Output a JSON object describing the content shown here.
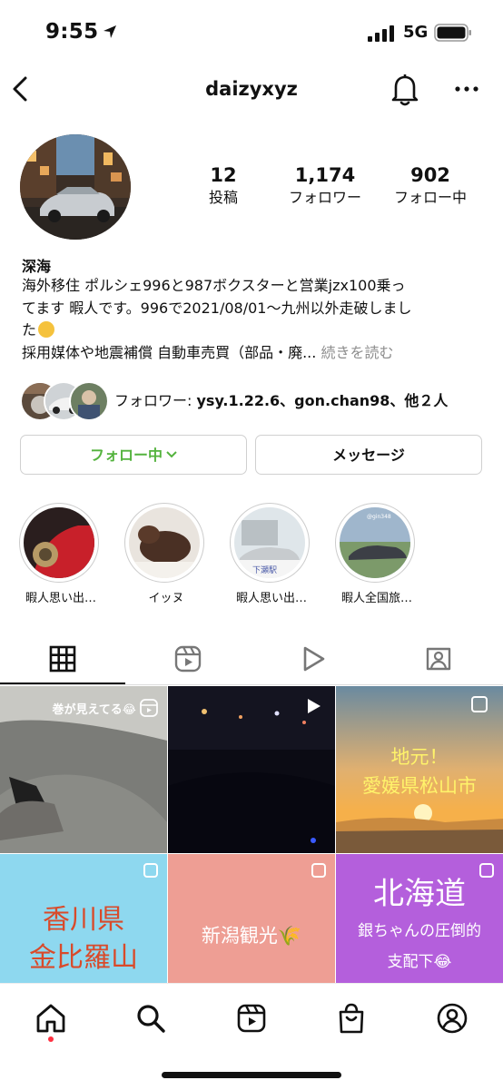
{
  "status_bar": {
    "time": "9:55",
    "network": "5G"
  },
  "header": {
    "username": "daizyxyz"
  },
  "profile": {
    "display_name": "深海",
    "stats": [
      {
        "value": "12",
        "label": "投稿"
      },
      {
        "value": "1,174",
        "label": "フォロワー"
      },
      {
        "value": "902",
        "label": "フォロー中"
      }
    ],
    "bio_lines": [
      "海外移住 ポルシェ996と987ボクスターと営業jzx100乗っ",
      "てます 暇人です。996で2021/08/01〜九州以外走破しまし",
      "た",
      "採用媒体や地震補償 自動車売買（部品・廃..."
    ],
    "bio_more": "続きを読む",
    "mutual_followers": {
      "prefix": "フォロワー: ",
      "names": "ysy.1.22.6、gon.chan98",
      "suffix": "、他２人"
    }
  },
  "actions": {
    "follow_label": "フォロー中",
    "message_label": "メッセージ"
  },
  "highlights": [
    {
      "label": "暇人思い出…"
    },
    {
      "label": "イッヌ"
    },
    {
      "label": "暇人思い出…"
    },
    {
      "label": "暇人全国旅…"
    }
  ],
  "highlight_texts": {
    "station_sign": "下瀬駅",
    "tag": "@gin348"
  },
  "grid": {
    "post1_caption": "巻が見えてる😂",
    "post3_text": [
      "地元！",
      "愛媛県松山市"
    ],
    "post4_text": [
      "香川県",
      "金比羅山"
    ],
    "post5_text": "新潟観光🌾",
    "post6_text": [
      "北海道",
      "銀ちゃんの圧倒的",
      "支配下😂"
    ]
  },
  "colors": {
    "follow_green": "#54b33e",
    "post4_bg": "#8ed8ef",
    "post4_text": "#d94a2a",
    "post5_bg": "#ee9e94",
    "post6_bg": "#b45fdc",
    "notification_dot": "#ff3040"
  },
  "icons": [
    "location-arrow-icon",
    "signal-icon",
    "battery-icon",
    "back-chevron-icon",
    "bell-icon",
    "more-icon",
    "chevron-down-icon",
    "grid-icon",
    "reels-icon",
    "play-icon",
    "tagged-icon",
    "home-icon",
    "search-icon",
    "shop-icon",
    "profile-icon",
    "multi-post-icon"
  ]
}
